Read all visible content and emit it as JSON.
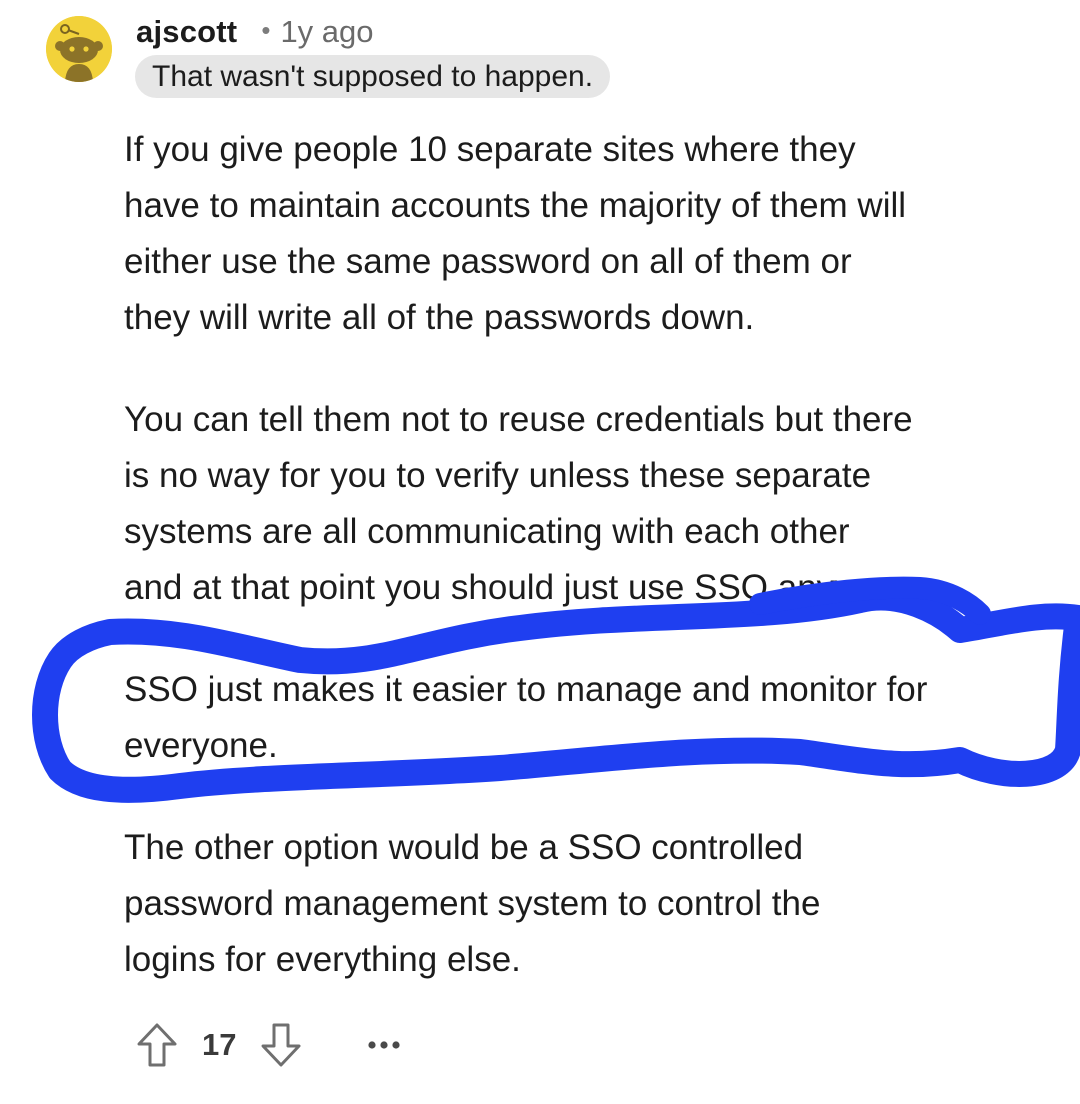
{
  "comment": {
    "username": "ajscott",
    "separator": "•",
    "timestamp": "1y ago",
    "flair": "That wasn't supposed to happen.",
    "avatar_icon": "reddit-snoo-avatar-icon",
    "paragraphs": [
      {
        "lines": [
          "If you give people 10 separate sites where they",
          "have to maintain accounts the majority of them will",
          "either use the same password on all of them or",
          "they will write all of the passwords down."
        ]
      },
      {
        "lines": [
          "You can tell them not to reuse credentials but there",
          "is no way for you to verify unless these separate",
          "systems are all communicating with each other",
          "and at that point you should just use SSO anyway."
        ]
      },
      {
        "lines": [
          "SSO just makes it easier to manage and monitor for",
          "everyone."
        ]
      },
      {
        "lines": [
          "The other option would be a SSO controlled",
          "password management system to control the",
          "logins for everything else."
        ]
      }
    ],
    "highlight_color": "#1f3ff0",
    "actions": {
      "upvote_icon": "arrow-up-icon",
      "score": "17",
      "downvote_icon": "arrow-down-icon",
      "more_icon": "more-options-icon"
    }
  }
}
